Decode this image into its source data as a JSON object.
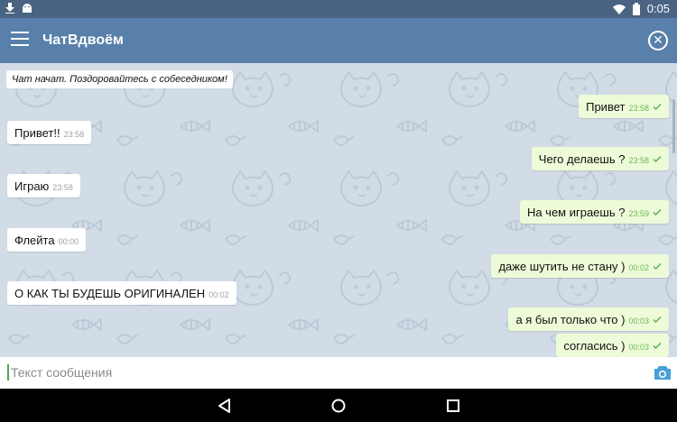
{
  "status_bar": {
    "time": "0:05",
    "icons": [
      "download-icon",
      "android-icon",
      "wifi-icon",
      "battery-icon"
    ]
  },
  "app_bar": {
    "title": "ЧатВдвоём",
    "menu_icon": "hamburger-menu-icon",
    "close_icon": "close-circle-icon"
  },
  "chat": {
    "service_message": "Чат начат. Поздоровайтесь с собеседником!",
    "messages": [
      {
        "side": "out",
        "text": "Привет",
        "time": "23:58"
      },
      {
        "side": "in",
        "text": "Привет!!",
        "time": "23:58"
      },
      {
        "side": "out",
        "text": "Чего делаешь ?",
        "time": "23:58"
      },
      {
        "side": "in",
        "text": "Играю",
        "time": "23:58"
      },
      {
        "side": "out",
        "text": "На чем играешь ?",
        "time": "23:59"
      },
      {
        "side": "in",
        "text": "Флейта",
        "time": "00:00"
      },
      {
        "side": "out",
        "text": "даже шутить не стану )",
        "time": "00:02"
      },
      {
        "side": "in",
        "text": "О КАК ТЫ БУДЕШЬ ОРИГИНАЛЕН",
        "time": "00:02"
      },
      {
        "side": "out",
        "text": "а я был только что )",
        "time": "00:03"
      },
      {
        "side": "out",
        "text": "согласись )",
        "time": "00:03"
      }
    ]
  },
  "input": {
    "placeholder": "Текст сообщения",
    "value": "",
    "attach_icon": "camera-icon"
  },
  "nav_bar": {
    "icons": [
      "back-icon",
      "home-icon",
      "recents-icon"
    ]
  },
  "colors": {
    "status_bar": "#4a6383",
    "app_bar": "#5880aa",
    "chat_background": "#d2dce6",
    "incoming_bubble": "#ffffff",
    "outgoing_bubble": "#eefbd8",
    "accent": "#4a9fd8"
  }
}
